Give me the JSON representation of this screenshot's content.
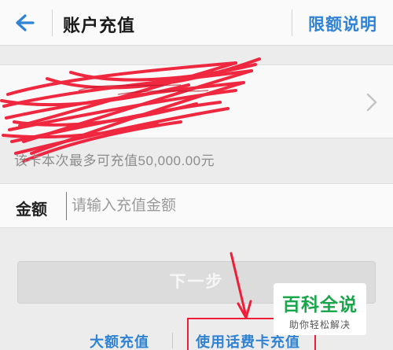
{
  "header": {
    "title": "账户充值",
    "limit_link": "限额说明",
    "back_icon": "arrow-left-icon"
  },
  "card": {
    "chevron_icon": "chevron-right-icon"
  },
  "hint": "该卡本次最多可充值50,000.00元",
  "amount": {
    "label": "金额",
    "placeholder": "请输入充值金额",
    "value": ""
  },
  "next_button": "下一步",
  "links": {
    "big_amount": "大额充值",
    "phone_card": "使用话费卡充值"
  },
  "watermark": {
    "main": "百科全说",
    "sub": "助你轻松解决"
  },
  "colors": {
    "accent": "#2f82d4",
    "annotation": "#ef1d37",
    "watermark_green": "#1aa64a"
  }
}
